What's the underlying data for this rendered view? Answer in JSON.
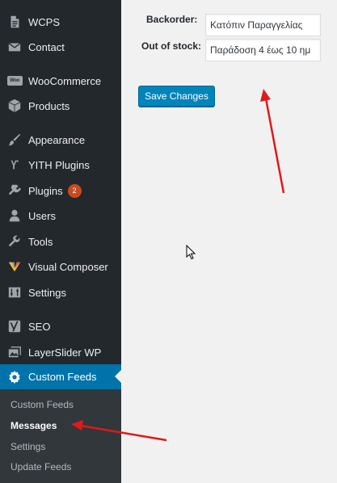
{
  "sidebar": {
    "items": [
      {
        "label": "WCPS",
        "icon": "document-icon"
      },
      {
        "label": "Contact",
        "icon": "mail-icon"
      },
      {
        "label": "WooCommerce",
        "icon": "woocommerce-icon"
      },
      {
        "label": "Products",
        "icon": "box-icon"
      },
      {
        "label": "Appearance",
        "icon": "brush-icon"
      },
      {
        "label": "YITH Plugins",
        "icon": "yith-icon"
      },
      {
        "label": "Plugins",
        "icon": "plugin-icon",
        "badge": "2"
      },
      {
        "label": "Users",
        "icon": "user-icon"
      },
      {
        "label": "Tools",
        "icon": "wrench-icon"
      },
      {
        "label": "Visual Composer",
        "icon": "visual-composer-icon"
      },
      {
        "label": "Settings",
        "icon": "settings-sliders-icon"
      },
      {
        "label": "SEO",
        "icon": "yoast-icon"
      },
      {
        "label": "LayerSlider WP",
        "icon": "layers-icon"
      },
      {
        "label": "Custom Feeds",
        "icon": "gear-icon"
      }
    ],
    "woo_logo_text": "Woo",
    "submenu": [
      {
        "label": "Custom Feeds"
      },
      {
        "label": "Messages"
      },
      {
        "label": "Settings"
      },
      {
        "label": "Update Feeds"
      }
    ]
  },
  "form": {
    "backorder_label": "Backorder:",
    "backorder_value": "Κατόπιν Παραγγελίας",
    "out_of_stock_label": "Out of stock:",
    "out_of_stock_value": "Παράδοση 4 έως 10 ημ",
    "save_label": "Save Changes"
  },
  "colors": {
    "sidebar_bg": "#23282d",
    "submenu_bg": "#32373c",
    "current_item_bg": "#0073aa",
    "button_bg": "#0085ba",
    "badge_bg": "#ca4a1f",
    "annotation_arrow": "#e0191b"
  }
}
